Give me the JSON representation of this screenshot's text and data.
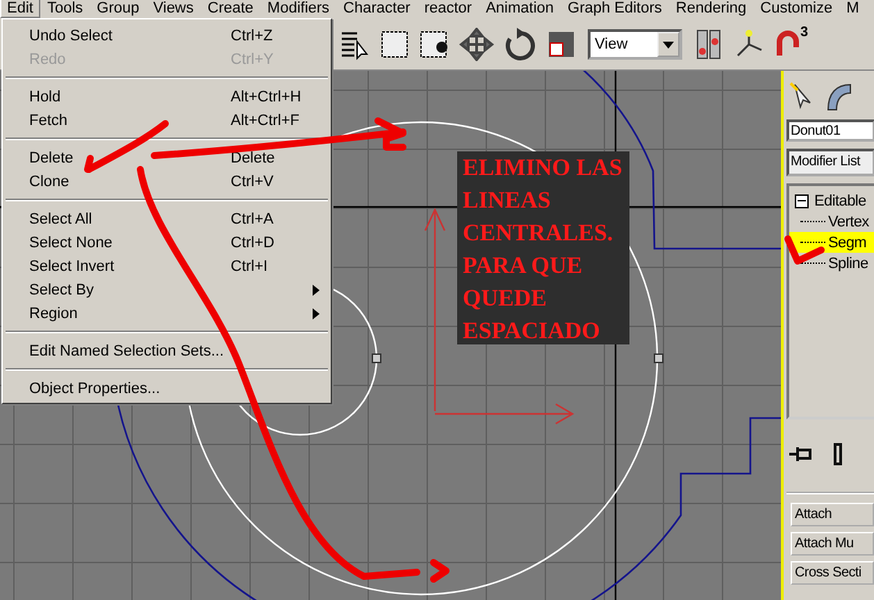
{
  "menubar": [
    {
      "label": "Edit",
      "selected": true
    },
    {
      "label": "Tools",
      "selected": false
    },
    {
      "label": "Group",
      "selected": false
    },
    {
      "label": "Views",
      "selected": false
    },
    {
      "label": "Create",
      "selected": false
    },
    {
      "label": "Modifiers",
      "selected": false
    },
    {
      "label": "Character",
      "selected": false
    },
    {
      "label": "reactor",
      "selected": false
    },
    {
      "label": "Animation",
      "selected": false
    },
    {
      "label": "Graph Editors",
      "selected": false
    },
    {
      "label": "Rendering",
      "selected": false
    },
    {
      "label": "Customize",
      "selected": false
    },
    {
      "label": "M",
      "selected": false
    }
  ],
  "edit_menu": [
    {
      "kind": "item",
      "label": "Undo Select",
      "shortcut": "Ctrl+Z",
      "disabled": false,
      "submenu": false
    },
    {
      "kind": "item",
      "label": "Redo",
      "shortcut": "Ctrl+Y",
      "disabled": true,
      "submenu": false
    },
    {
      "kind": "separator"
    },
    {
      "kind": "item",
      "label": "Hold",
      "shortcut": "Alt+Ctrl+H",
      "disabled": false,
      "submenu": false
    },
    {
      "kind": "item",
      "label": "Fetch",
      "shortcut": "Alt+Ctrl+F",
      "disabled": false,
      "submenu": false
    },
    {
      "kind": "separator"
    },
    {
      "kind": "item",
      "label": "Delete",
      "shortcut": "Delete",
      "disabled": false,
      "submenu": false
    },
    {
      "kind": "item",
      "label": "Clone",
      "shortcut": "Ctrl+V",
      "disabled": false,
      "submenu": false
    },
    {
      "kind": "separator"
    },
    {
      "kind": "item",
      "label": "Select All",
      "shortcut": "Ctrl+A",
      "disabled": false,
      "submenu": false
    },
    {
      "kind": "item",
      "label": "Select None",
      "shortcut": "Ctrl+D",
      "disabled": false,
      "submenu": false
    },
    {
      "kind": "item",
      "label": "Select Invert",
      "shortcut": "Ctrl+I",
      "disabled": false,
      "submenu": false
    },
    {
      "kind": "item",
      "label": "Select By",
      "disabled": false,
      "submenu": true
    },
    {
      "kind": "item",
      "label": "Region",
      "disabled": false,
      "submenu": true
    },
    {
      "kind": "separator"
    },
    {
      "kind": "item",
      "label": "Edit Named Selection Sets...",
      "disabled": false,
      "submenu": false
    },
    {
      "kind": "separator"
    },
    {
      "kind": "item",
      "label": "Object Properties...",
      "disabled": false,
      "submenu": false
    }
  ],
  "toolbar": {
    "reference_dropdown": {
      "value": "View"
    },
    "snap_label": "3"
  },
  "viewport": {
    "annotation": [
      "ELIMINO LAS",
      "LINEAS",
      "CENTRALES.",
      "PARA QUE",
      "QUEDE",
      "ESPACIADO"
    ]
  },
  "command_panel": {
    "object_name": "Donut01",
    "modifier_list": "Modifier List",
    "stack": [
      {
        "label": "Editable",
        "expanded": true,
        "selected": false,
        "children": [
          {
            "label": "Vertex",
            "selected": false
          },
          {
            "label": "Segm",
            "selected": true
          },
          {
            "label": "Spline",
            "selected": false
          }
        ]
      }
    ],
    "buttons": [
      "Attach",
      "Attach Mu",
      "Cross Secti"
    ]
  }
}
